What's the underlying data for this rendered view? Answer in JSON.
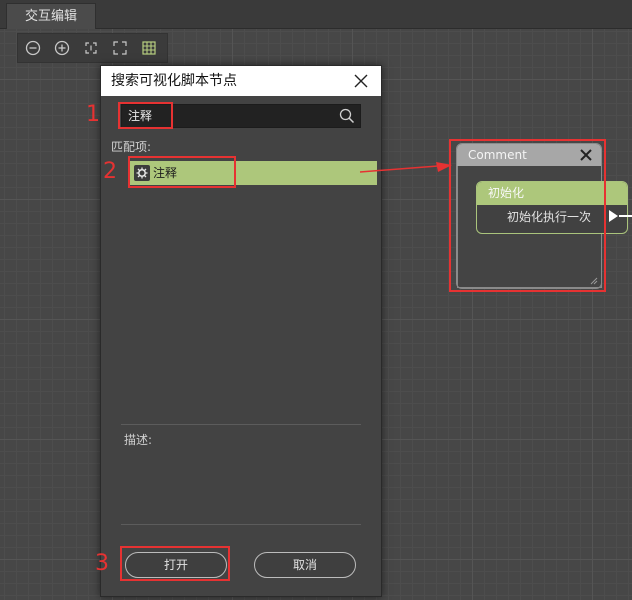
{
  "window": {
    "tab_label": "交互编辑"
  },
  "toolbar": {
    "buttons": [
      {
        "icon": "zoom-out-icon"
      },
      {
        "icon": "zoom-in-icon"
      },
      {
        "icon": "fit-selection-icon"
      },
      {
        "icon": "fullscreen-icon"
      },
      {
        "icon": "grid-icon"
      }
    ]
  },
  "dialog": {
    "title": "搜索可视化脚本节点",
    "search_value": "注释",
    "match_label": "匹配项:",
    "results": [
      {
        "label": "注释",
        "icon": "script-node-icon"
      }
    ],
    "description_label": "描述:",
    "open_label": "打开",
    "cancel_label": "取消"
  },
  "comment_node": {
    "title": "Comment"
  },
  "event_node": {
    "title": "初始化",
    "port_label": "初始化执行一次"
  },
  "annotations": {
    "step1": "1",
    "step2": "2",
    "step3": "3"
  },
  "colors": {
    "highlight_green": "#adc77b",
    "annotation_red": "#e63232",
    "canvas": "#474747"
  }
}
